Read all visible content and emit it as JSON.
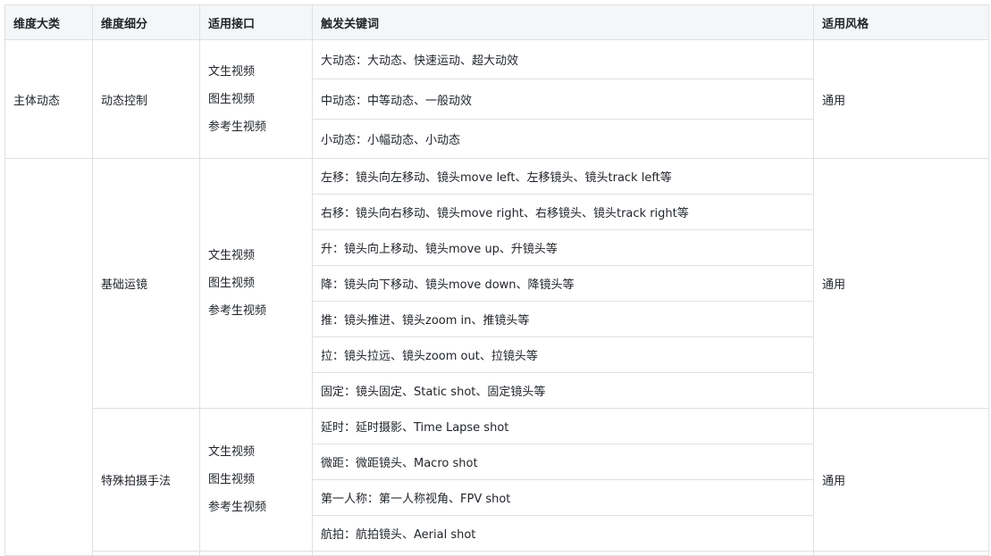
{
  "headers": [
    "维度大类",
    "维度细分",
    "适用接口",
    "触发关键词",
    "适用风格"
  ],
  "groups": [
    {
      "category": "主体动态",
      "subcategory": "动态控制",
      "interfaces": [
        "文生视频",
        "图生视频",
        "参考生视频"
      ],
      "style": "通用",
      "keywords": [
        "大动态：大动态、快速运动、超大动效",
        "中动态：中等动态、一般动效",
        "小动态：小幅动态、小动态"
      ]
    },
    {
      "category": "",
      "subcategory": "基础运镜",
      "interfaces": [
        "文生视频",
        "图生视频",
        "参考生视频"
      ],
      "style": "通用",
      "keywords": [
        "左移：镜头向左移动、镜头move left、左移镜头、镜头track left等",
        "右移：镜头向右移动、镜头move right、右移镜头、镜头track right等",
        "升：镜头向上移动、镜头move up、升镜头等",
        "降：镜头向下移动、镜头move down、降镜头等",
        "推：镜头推进、镜头zoom in、推镜头等",
        "拉：镜头拉远、镜头zoom out、拉镜头等",
        "固定：镜头固定、Static shot、固定镜头等"
      ]
    },
    {
      "subcategory": "特殊拍摄手法",
      "interfaces": [
        "文生视频",
        "图生视频",
        "参考生视频"
      ],
      "style": "通用",
      "keywords": [
        "延时：延时摄影、Time Lapse shot",
        "微距：微距镜头、Macro shot",
        "第一人称：第一人称视角、FPV shot",
        "航拍：航拍镜头、Aerial shot"
      ]
    }
  ]
}
